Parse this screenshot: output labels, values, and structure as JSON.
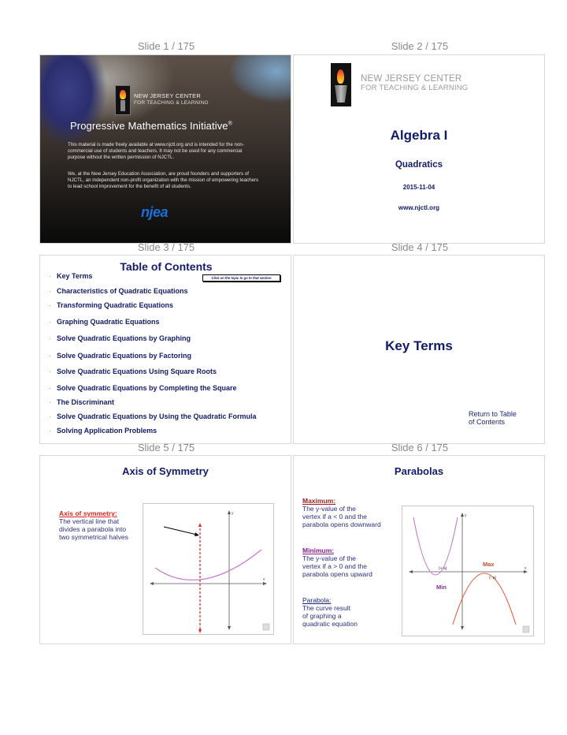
{
  "slides": [
    {
      "label": "Slide 1 / 175",
      "brand_line1": "NEW JERSEY CENTER",
      "brand_line2": "FOR TEACHING & LEARNING",
      "title": "Progressive Mathematics Initiative",
      "title_mark": "®",
      "paragraph1": "This material is made freely available at www.njctl.org and is intended for the non-commercial use of students and teachers. It may not be used for any commercial purpose without the written permission of NJCTL.",
      "paragraph2": "We, at the New Jersey Education Association, are proud founders and supporters of NJCTL, an independent non-profit organization with the mission of empowering teachers to lead school improvement for the benefit of all students.",
      "logo_text": "njea"
    },
    {
      "label": "Slide 2 / 175",
      "brand_line1": "NEW JERSEY CENTER",
      "brand_line2": "FOR TEACHING & LEARNING",
      "title": "Algebra I",
      "subtitle": "Quadratics",
      "date": "2015-11-04",
      "url": "www.njctl.org"
    },
    {
      "label": "Slide 3 / 175",
      "title": "Table of Contents",
      "hint": "Click on the topic to go to that section",
      "bullet": "·",
      "items": [
        "Key Terms",
        "Characteristics of Quadratic Equations",
        "Transforming Quadratic Equations",
        "Graphing Quadratic Equations",
        "Solve Quadratic Equations by Graphing",
        "Solve Quadratic Equations by Factoring",
        "Solve Quadratic Equations Using Square Roots",
        "Solve Quadratic Equations by Completing the Square",
        "The Discriminant",
        "Solve Quadratic Equations by Using the Quadratic Formula",
        "Solving Application Problems"
      ]
    },
    {
      "label": "Slide 4 / 175",
      "title": "Key Terms",
      "return_line1": "Return to Table",
      "return_line2": "of Contents"
    },
    {
      "label": "Slide 5 / 175",
      "title": "Axis of Symmetry",
      "term": "Axis of symmetry:",
      "definition_lines": [
        "The vertical line  that",
        "divides a parabola into",
        "two symmetrical halves"
      ],
      "axis_x": "x",
      "axis_y": "y"
    },
    {
      "label": "Slide 6 / 175",
      "title": "Parabolas",
      "maximum_term": "Maximum:",
      "maximum_lines": [
        "The y-value of the",
        "vertex if a < 0 and the",
        "parabola opens downward"
      ],
      "minimum_term": "Minimum:",
      "minimum_lines": [
        "The y-value of the",
        "vertex if a > 0 and the",
        "parabola opens upward"
      ],
      "parabola_term": "Parabola:",
      "parabola_lines": [
        "The curve result",
        "of graphing a",
        "quadratic equation"
      ],
      "graph_max_label": "Max",
      "graph_min_label": "Min",
      "graph_pos_a": "(+ a)",
      "graph_neg_a": "(- a)",
      "axis_x": "x",
      "axis_y": "y"
    }
  ],
  "colors": {
    "navy": "#121b6b",
    "red_term": "#e32222",
    "max_color": "#e8603c",
    "min_color": "#c77bd0"
  }
}
